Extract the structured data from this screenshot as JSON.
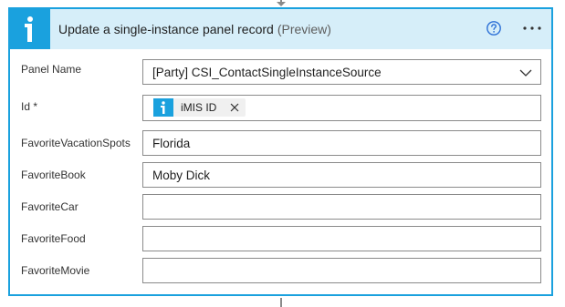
{
  "action": {
    "title": "Update a single-instance panel record",
    "preview_tag": "(Preview)",
    "icons": {
      "logo": "imis-logo-icon",
      "help": "help-circle-icon",
      "more": "more-options-icon"
    }
  },
  "fields": {
    "panel_name": {
      "label": "Panel Name",
      "value": "[Party] CSI_ContactSingleInstanceSource"
    },
    "id": {
      "label": "Id *",
      "token_label": "iMIS ID"
    },
    "favorite_vacation_spots": {
      "label": "FavoriteVacationSpots",
      "value": "Florida"
    },
    "favorite_book": {
      "label": "FavoriteBook",
      "value": "Moby Dick"
    },
    "favorite_car": {
      "label": "FavoriteCar",
      "value": ""
    },
    "favorite_food": {
      "label": "FavoriteFood",
      "value": ""
    },
    "favorite_movie": {
      "label": "FavoriteMovie",
      "value": ""
    }
  },
  "colors": {
    "accent": "#1aa1de",
    "header_bg": "#d6eef9",
    "border": "#8a8a8a"
  }
}
